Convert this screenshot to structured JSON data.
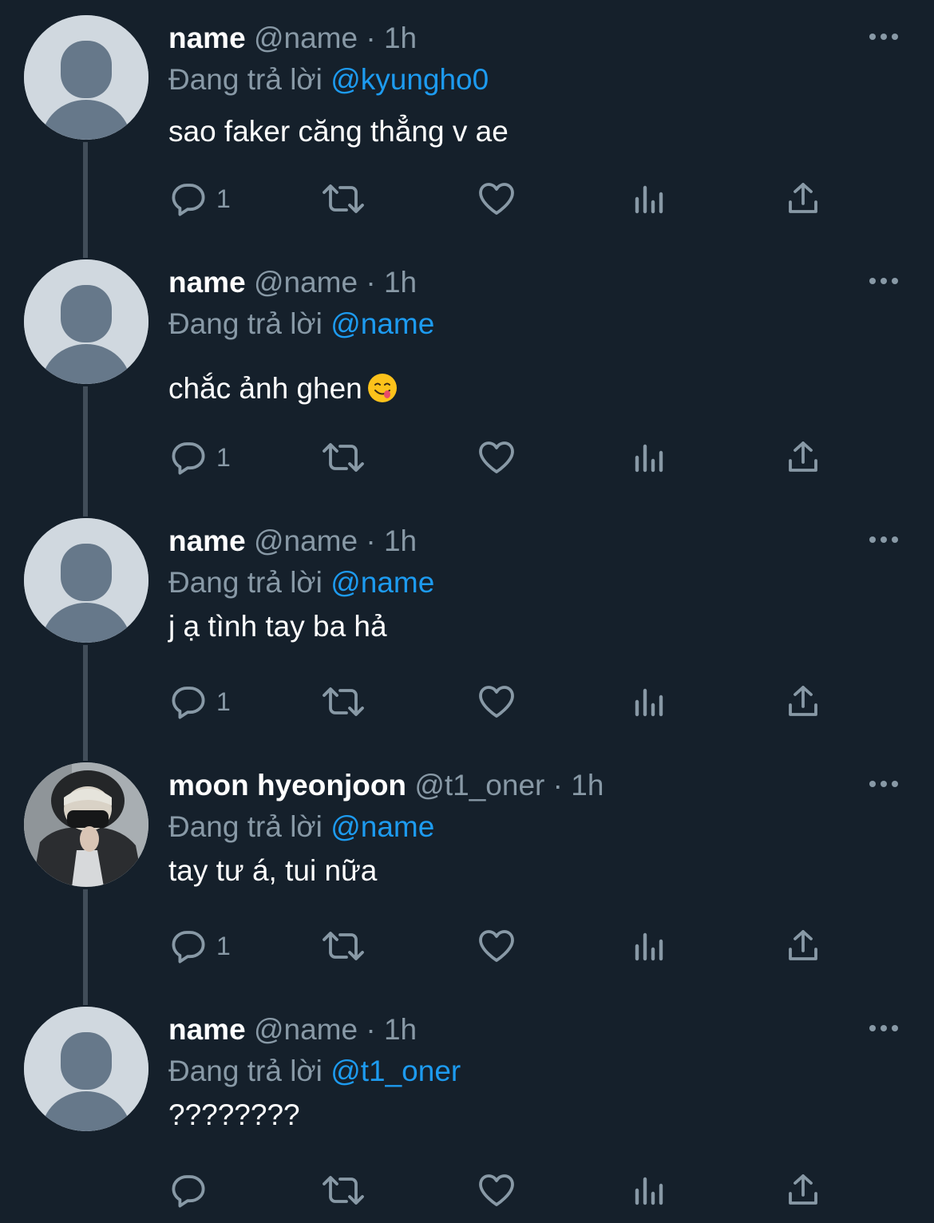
{
  "thread": {
    "tweets": [
      {
        "display_name": "name",
        "handle": "@name",
        "separator": "·",
        "time": "1h",
        "reply_prefix": "Đang trả lời",
        "reply_to": "@kyungho0",
        "text": "sao faker căng thẳng v ae",
        "reply_count": "1",
        "avatar": "default-avatar"
      },
      {
        "display_name": "name",
        "handle": "@name",
        "separator": "·",
        "time": "1h",
        "reply_prefix": "Đang trả lời",
        "reply_to": "@name",
        "text": "chắc ảnh ghen",
        "emoji": "face-savoring-food-emoji",
        "reply_count": "1",
        "avatar": "default-avatar"
      },
      {
        "display_name": "name",
        "handle": "@name",
        "separator": "·",
        "time": "1h",
        "reply_prefix": "Đang trả lời",
        "reply_to": "@name",
        "text": "j ạ tình tay ba hả",
        "reply_count": "1",
        "avatar": "default-avatar"
      },
      {
        "display_name": "moon hyeonjoon",
        "handle": "@t1_oner",
        "separator": "·",
        "time": "1h",
        "reply_prefix": "Đang trả lời",
        "reply_to": "@name",
        "text": "tay tư á, tui nữa",
        "reply_count": "1",
        "avatar": "profile-photo"
      },
      {
        "display_name": "name",
        "handle": "@name",
        "separator": "·",
        "time": "1h",
        "reply_prefix": "Đang trả lời",
        "reply_to": "@t1_oner",
        "text": "????????",
        "reply_count": "",
        "avatar": "default-avatar"
      }
    ]
  },
  "icons": {
    "reply": "reply-icon",
    "retweet": "retweet-icon",
    "like": "heart-icon",
    "views": "analytics-icon",
    "share": "share-icon",
    "more": "more-icon"
  },
  "colors": {
    "background": "#15202b",
    "text": "#ffffff",
    "secondary": "#8899a6",
    "mention": "#1d9bf0",
    "thread_line": "#414d59"
  }
}
